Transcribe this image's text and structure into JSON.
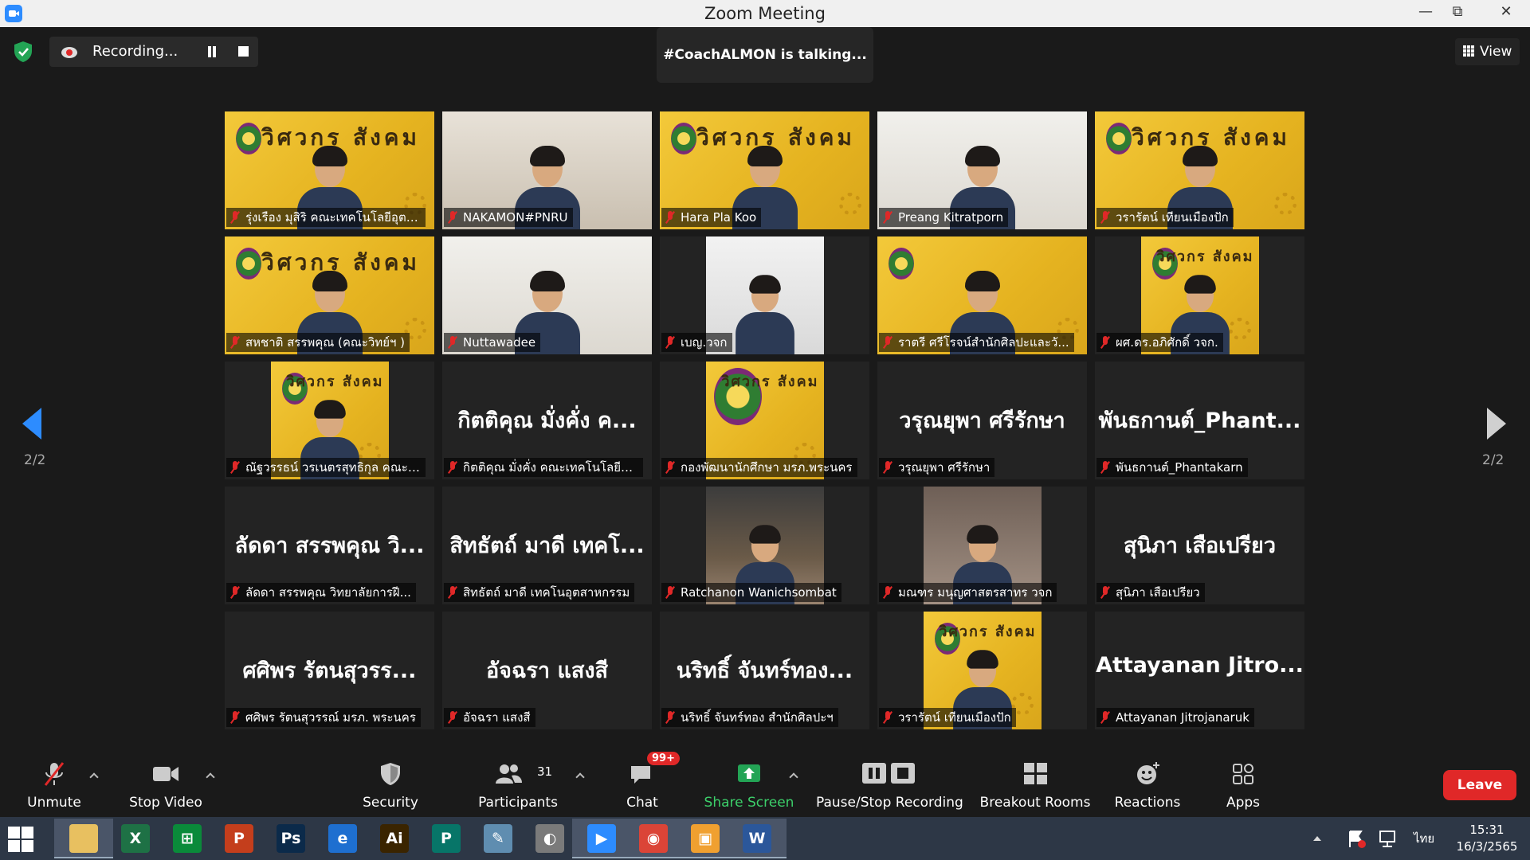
{
  "window": {
    "title": "Zoom Meeting"
  },
  "top": {
    "recording_label": "Recording...",
    "talking_label": "#CoachALMON is talking...",
    "view_label": "View"
  },
  "pagination": {
    "left": "2/2",
    "right": "2/2"
  },
  "tiles": [
    {
      "name": "รุ่งเรือง มุสิริ คณะเทคโนโลยีอุตส...",
      "video": "yellow",
      "banner": "วิศวกร สังคม"
    },
    {
      "name": "NAKAMON#PNRU",
      "video": "office"
    },
    {
      "name": "Hara Pla Koo",
      "video": "yellow",
      "banner": "วิศวกร สังคม"
    },
    {
      "name": "Preang Kitratporn",
      "video": "wall"
    },
    {
      "name": "วรารัตน์ เทียนเมืองปัก",
      "video": "yellow",
      "banner": "วิศวกร สังคม"
    },
    {
      "name": "สหชาติ สรรพคุณ (คณะวิทย์ฯ )",
      "video": "yellow",
      "banner": "วิศวกร สังคม"
    },
    {
      "name": "Nuttawadee",
      "video": "wall"
    },
    {
      "name": "เบญ.วจก",
      "video": "white-narrow"
    },
    {
      "name": "ราตรี ศรีโรจน์สำนักศิลปะและวั...",
      "video": "yellow"
    },
    {
      "name": "ผศ.ดร.อภิศักดิ์ วจก.",
      "video": "yellow-narrow",
      "banner": "วิศวกร สังคม"
    },
    {
      "name": "ณัฐวรรธน์ วรเนตรสุทธิกุล คณะเ...",
      "video": "yellow-narrow",
      "banner": "วิศวกร สังคม"
    },
    {
      "name": "กิตติคุณ มั่งคั่ง คณะเทคโนโลยีอุ...",
      "big": "กิตติคุณ มั่งคั่ง ค..."
    },
    {
      "name": "กองพัฒนานักศึกษา มรภ.พระนคร",
      "video": "logo-narrow",
      "banner": "วิศวกร สังคม"
    },
    {
      "name": "วรุณยุพา ศรีรักษา",
      "big": "วรุณยุพา ศรีรักษา"
    },
    {
      "name": "พันธกานต์_Phantakarn",
      "big": "พันธกานต์_Phant..."
    },
    {
      "name": "ลัดดา สรรพคุณ วิทยาลัยการฝี...",
      "big": "ลัดดา สรรพคุณ วิ..."
    },
    {
      "name": "สิทธัตถ์ มาดี เทคโนอุตสาหกรรม",
      "big": "สิทธัตถ์ มาดี เทคโ..."
    },
    {
      "name": "Ratchanon Wanichsombat",
      "video": "cafe-narrow"
    },
    {
      "name": "มณฑร มนุญศาสตรสาทร วจก",
      "video": "indoor-narrow"
    },
    {
      "name": "สุนิภา เสือเปรียว",
      "big": "สุนิภา เสือเปรียว"
    },
    {
      "name": "ศศิพร รัตนสุวรรณ์ มรภ. พระนคร",
      "big": "ศศิพร รัตนสุวรร..."
    },
    {
      "name": "อัจฉรา แสงสี",
      "big": "อัจฉรา แสงสี"
    },
    {
      "name": "นริทธิ์ จันทร์ทอง สำนักศิลปะฯ",
      "big": "นริทธิ์ จันทร์ทอง..."
    },
    {
      "name": "วรารัตน์ เทียนเมืองปัก",
      "video": "yellow-narrow",
      "banner": "วิศวกร สังคม"
    },
    {
      "name": "Attayanan Jitrojanaruk",
      "big": "Attayanan Jitro..."
    }
  ],
  "toolbar": {
    "unmute": "Unmute",
    "stop_video": "Stop Video",
    "security": "Security",
    "participants": "Participants",
    "participants_count": "31",
    "chat": "Chat",
    "chat_badge": "99+",
    "share_screen": "Share Screen",
    "pause_stop_recording": "Pause/Stop Recording",
    "breakout_rooms": "Breakout Rooms",
    "reactions": "Reactions",
    "apps": "Apps",
    "leave": "Leave"
  },
  "taskbar": {
    "apps": [
      {
        "icon": "file-explorer-icon",
        "glyph": "",
        "color": "#e8c060"
      },
      {
        "icon": "excel-icon",
        "glyph": "X",
        "color": "#1e7145"
      },
      {
        "icon": "store-icon",
        "glyph": "⊞",
        "color": "#0a8a3a"
      },
      {
        "icon": "powerpoint-icon",
        "glyph": "P",
        "color": "#c43e1c"
      },
      {
        "icon": "photoshop-icon",
        "glyph": "Ps",
        "color": "#0b2a4a"
      },
      {
        "icon": "internet-explorer-icon",
        "glyph": "e",
        "color": "#1e6fd0"
      },
      {
        "icon": "illustrator-icon",
        "glyph": "Ai",
        "color": "#3a2400"
      },
      {
        "icon": "publisher-icon",
        "glyph": "P",
        "color": "#077568"
      },
      {
        "icon": "notes-icon",
        "glyph": "✎",
        "color": "#5f8db0"
      },
      {
        "icon": "photoscape-icon",
        "glyph": "◐",
        "color": "#7a7a7a"
      },
      {
        "icon": "zoom-icon",
        "glyph": "▶",
        "color": "#2d8cff"
      },
      {
        "icon": "chrome-icon",
        "glyph": "◉",
        "color": "#db4437"
      },
      {
        "icon": "image-viewer-icon",
        "glyph": "▣",
        "color": "#f0a030"
      },
      {
        "icon": "word-icon",
        "glyph": "W",
        "color": "#2b579a"
      }
    ],
    "lang": "ไทย",
    "time": "15:31",
    "date": "16/3/2565"
  }
}
